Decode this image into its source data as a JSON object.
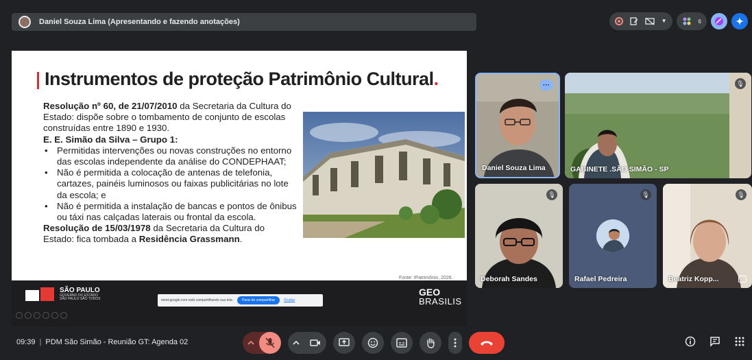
{
  "header": {
    "presenter_label": "Daniel Souza Lima (Apresentando e fazendo anotações)",
    "participant_count": "6"
  },
  "slide": {
    "title_main": "Instrumentos de proteção Patrimônio Cultural",
    "title_end": ".",
    "p1_bold": "Resolução nº 60, de 21/07/2010",
    "p1_rest": " da Secretaria da Cultura do Estado: dispõe sobre o tombamento de conjunto de escolas construídas entre 1890 e 1930.",
    "subheading": "E. E. Simão da Silva – Grupo 1:",
    "bullets": [
      "Permitidas intervenções ou novas construções no entorno das escolas independente da análise do CONDEPHAAT;",
      "Não é permitida a colocação de antenas de telefonia, cartazes, painéis luminosos ou faixas publicitárias no lote da escola; e",
      "Não é permitida a instalação de bancas e pontos de ônibus ou táxi nas calçadas laterais ou frontal da escola."
    ],
    "p2_bold": "Resolução de 15/03/1978",
    "p2_mid": " da Secretaria da Cultura do Estado: fica tombada a ",
    "p2_bold2": "Residência Grassmann",
    "p2_end": ".",
    "caption": "Fonte: IPatrimônio, 2026.",
    "footer": {
      "sp_title": "SÃO PAULO",
      "sp_sub1": "GOVERNO DO ESTADO",
      "sp_sub2": "SÃO PAULO SÃO TODOS",
      "share_message": "meet.google.com está compartilhando sua tela.",
      "share_stop": "Parar de compartilhar",
      "share_hide": "Ocultar",
      "geo_top": "GEO",
      "geo_bottom": "BRASILIS"
    }
  },
  "participants": [
    {
      "name": "Daniel Souza Lima",
      "muted": false
    },
    {
      "name": "GABINETE .SÃO SIMÃO - SP",
      "muted": true
    },
    {
      "name": "Deborah Sandes",
      "muted": true
    },
    {
      "name": "Rafael Pedreira",
      "muted": true
    },
    {
      "name": "Beatriz Kopp...",
      "muted": true
    }
  ],
  "footer_bar": {
    "time": "09:39",
    "meeting_title": "PDM São Simão - Reunião GT: Agenda 02"
  },
  "icons": {
    "record": "record-icon",
    "mic_off": "mic-off-icon",
    "camera": "camera-icon",
    "present": "present-icon",
    "emoji": "emoji-icon",
    "captions": "captions-icon",
    "hand": "raise-hand-icon",
    "more": "more-vert-icon",
    "hangup": "hangup-icon",
    "info": "info-icon",
    "chat": "chat-icon",
    "apps": "apps-icon"
  },
  "colors": {
    "background": "#202124",
    "hangup": "#ea4335",
    "accent_red": "#d32f2f",
    "gemini": "#1a73e8"
  }
}
